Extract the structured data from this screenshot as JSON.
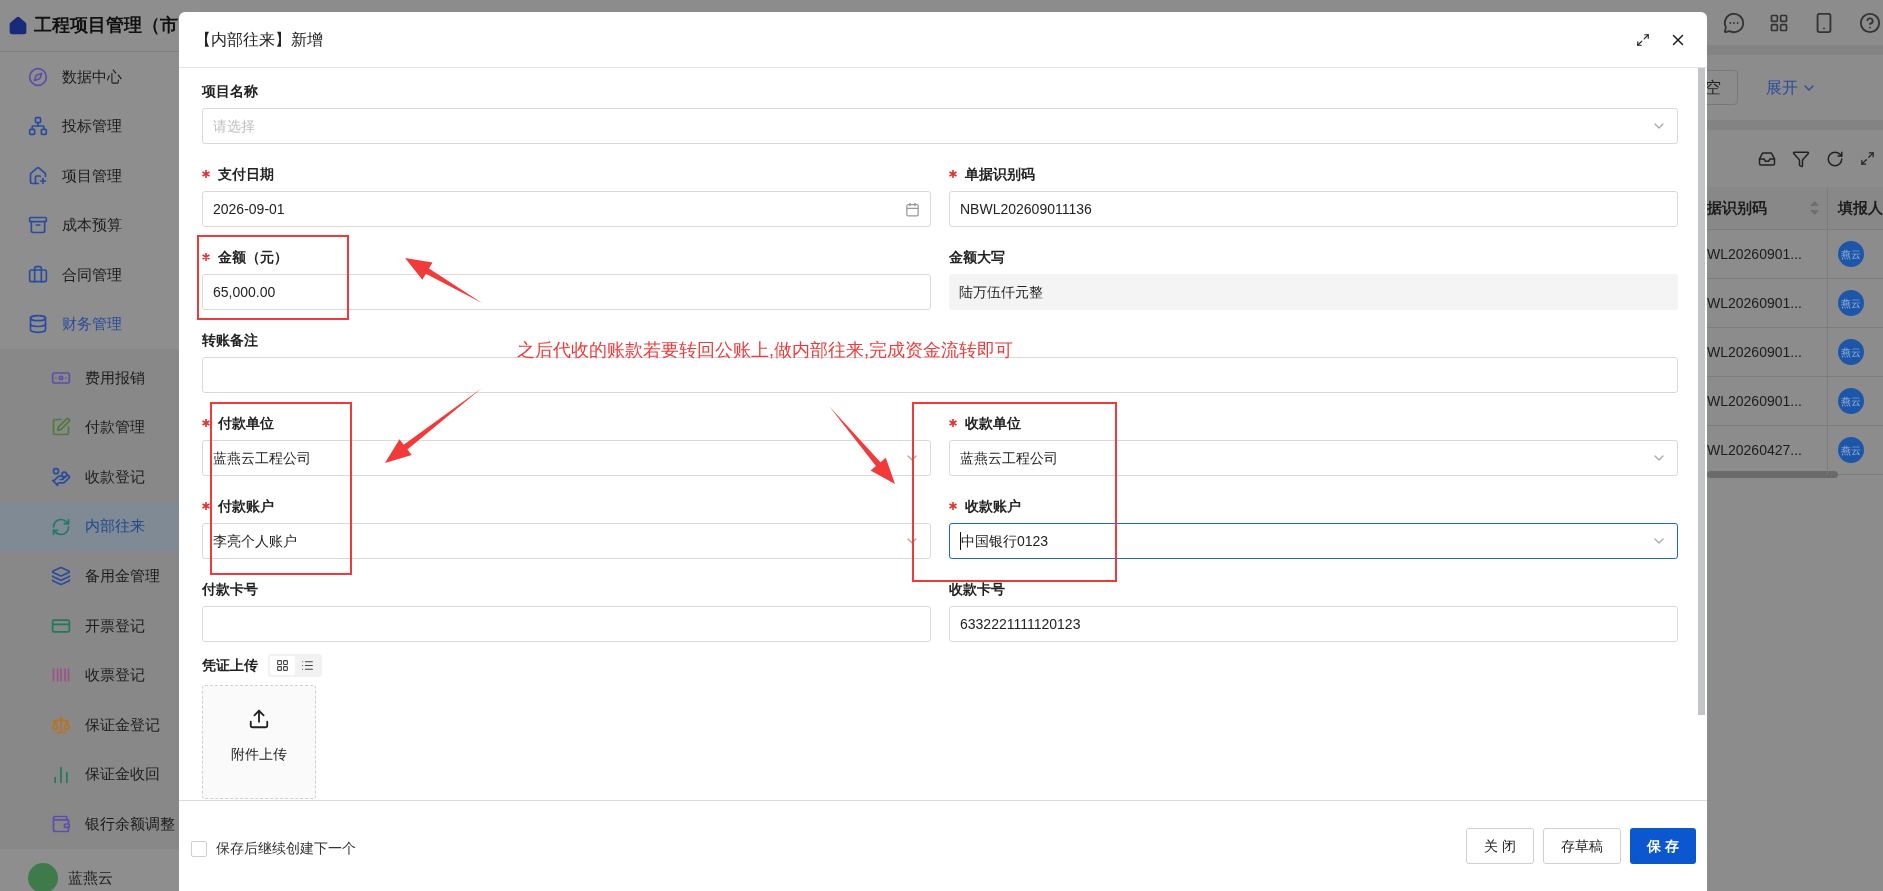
{
  "sidebar": {
    "title": "工程项目管理（市",
    "items": [
      {
        "label": "数据中心",
        "expanded": false,
        "selected": false
      },
      {
        "label": "投标管理",
        "expanded": false,
        "selected": false
      },
      {
        "label": "项目管理",
        "expanded": false,
        "selected": false
      },
      {
        "label": "成本预算",
        "expanded": false,
        "selected": false
      },
      {
        "label": "合同管理",
        "expanded": false,
        "selected": false
      },
      {
        "label": "财务管理",
        "expanded": true,
        "selected": false,
        "children": [
          {
            "label": "费用报销",
            "selected": false
          },
          {
            "label": "付款管理",
            "selected": false
          },
          {
            "label": "收款登记",
            "selected": false
          },
          {
            "label": "内部往来",
            "selected": true
          },
          {
            "label": "备用金管理",
            "selected": false
          },
          {
            "label": "开票登记",
            "selected": false
          },
          {
            "label": "收票登记",
            "selected": false
          },
          {
            "label": "保证金登记",
            "selected": false
          },
          {
            "label": "保证金收回",
            "selected": false
          },
          {
            "label": "银行余额调整",
            "selected": false
          }
        ]
      }
    ],
    "user": {
      "name": "蓝燕云"
    }
  },
  "search": {
    "button": "空",
    "expand_link": "展开"
  },
  "table": {
    "columns": [
      "据识别码",
      "填报人"
    ],
    "rows": [
      {
        "code": "WL20260901...",
        "reporter": "燕云"
      },
      {
        "code": "WL20260901...",
        "reporter": "燕云"
      },
      {
        "code": "WL20260901...",
        "reporter": "燕云"
      },
      {
        "code": "WL20260901...",
        "reporter": "燕云"
      },
      {
        "code": "WL20260427...",
        "reporter": "燕云"
      }
    ]
  },
  "dialog": {
    "title": "【内部往来】新增",
    "rows": [
      [
        {
          "label": "项目名称",
          "kind": "select",
          "required": false,
          "focused": false,
          "placeholder": "请选择"
        }
      ],
      [
        {
          "label": "支付日期",
          "kind": "date",
          "required": true,
          "focused": false,
          "value": "2026-09-01"
        },
        {
          "label": "单据识别码",
          "kind": "text",
          "required": true,
          "focused": false,
          "value": "NBWL202609011136"
        }
      ],
      [
        {
          "label": "金额（元）",
          "kind": "text",
          "required": true,
          "focused": false,
          "value": "65,000.00"
        },
        {
          "label": "金额大写",
          "kind": "readonly",
          "required": false,
          "focused": false,
          "value": "陆万伍仟元整"
        }
      ],
      [
        {
          "label": "转账备注",
          "kind": "text",
          "required": false,
          "focused": false
        }
      ],
      [
        {
          "label": "付款单位",
          "kind": "select",
          "required": true,
          "focused": false,
          "value": "蓝燕云工程公司"
        },
        {
          "label": "收款单位",
          "kind": "select",
          "required": true,
          "focused": false,
          "value": "蓝燕云工程公司"
        }
      ],
      [
        {
          "label": "付款账户",
          "kind": "select",
          "required": true,
          "focused": false,
          "value": "李亮个人账户"
        },
        {
          "label": "收款账户",
          "kind": "select",
          "required": true,
          "focused": true,
          "value": "中国银行0123"
        }
      ],
      [
        {
          "label": "付款卡号",
          "kind": "text",
          "required": false,
          "focused": false
        },
        {
          "label": "收款卡号",
          "kind": "text",
          "required": false,
          "focused": false,
          "value": "6332221111120123"
        }
      ]
    ],
    "upload": {
      "label": "凭证上传",
      "views": [
        {
          "kind": "grid",
          "selected": true
        },
        {
          "kind": "list",
          "selected": false
        }
      ],
      "button": "附件上传"
    },
    "footer": {
      "checkbox": {
        "label": "保存后继续创建下一个",
        "checked": false
      },
      "buttons": [
        {
          "label": "关 闭",
          "kind": "default"
        },
        {
          "label": "存草稿",
          "kind": "default"
        },
        {
          "label": "保 存",
          "kind": "primary"
        }
      ]
    }
  },
  "annotation": {
    "note": "之后代收的账款若要转回公账上,做内部往来,完成资金流转即可"
  }
}
